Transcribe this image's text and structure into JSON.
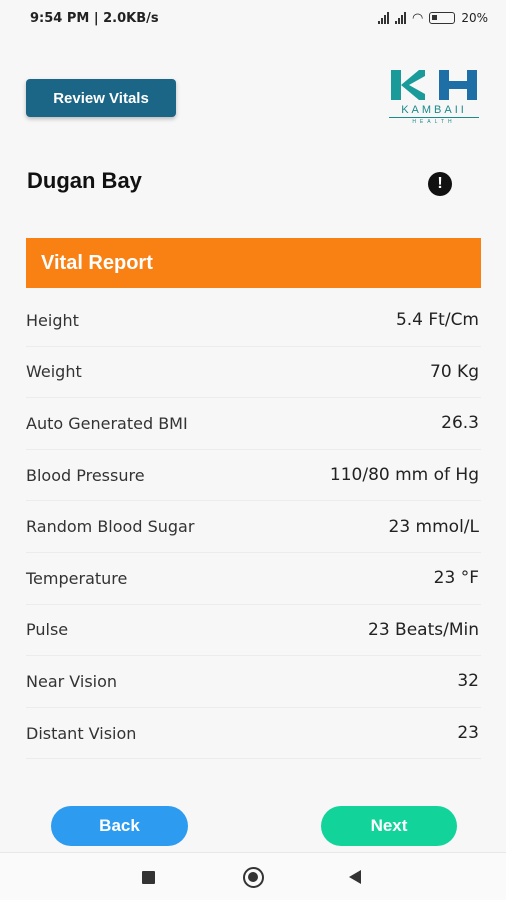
{
  "status_bar": {
    "time_net": "9:54 PM | 2.0KB/s",
    "battery_pct": "20",
    "icons": [
      "signal-icon",
      "signal-icon",
      "wifi-icon",
      "battery-icon"
    ]
  },
  "header": {
    "review_button_label": "Review Vitals",
    "logo": {
      "mark": "KH",
      "name": "KAMBAII",
      "sub": "HEALTH"
    }
  },
  "patient": {
    "name": "Dugan Bay",
    "info_icon": "!"
  },
  "report": {
    "title": "Vital Report",
    "rows": [
      {
        "label": "Height",
        "value": "5.4 Ft/Cm"
      },
      {
        "label": "Weight",
        "value": "70 Kg"
      },
      {
        "label": "Auto Generated BMI",
        "value": "26.3"
      },
      {
        "label": "Blood Pressure",
        "value": "110/80 mm of Hg"
      },
      {
        "label": "Random Blood Sugar",
        "value": "23 mmol/L"
      },
      {
        "label": "Temperature",
        "value": "23 °F"
      },
      {
        "label": "Pulse",
        "value": "23 Beats/Min"
      },
      {
        "label": "Near Vision",
        "value": "32"
      },
      {
        "label": "Distant Vision",
        "value": "23"
      }
    ]
  },
  "footer": {
    "back_label": "Back",
    "next_label": "Next"
  },
  "colors": {
    "primary": "#1b6586",
    "accent_orange": "#f98114",
    "back_blue": "#2d9bf0",
    "next_green": "#12d49b"
  }
}
